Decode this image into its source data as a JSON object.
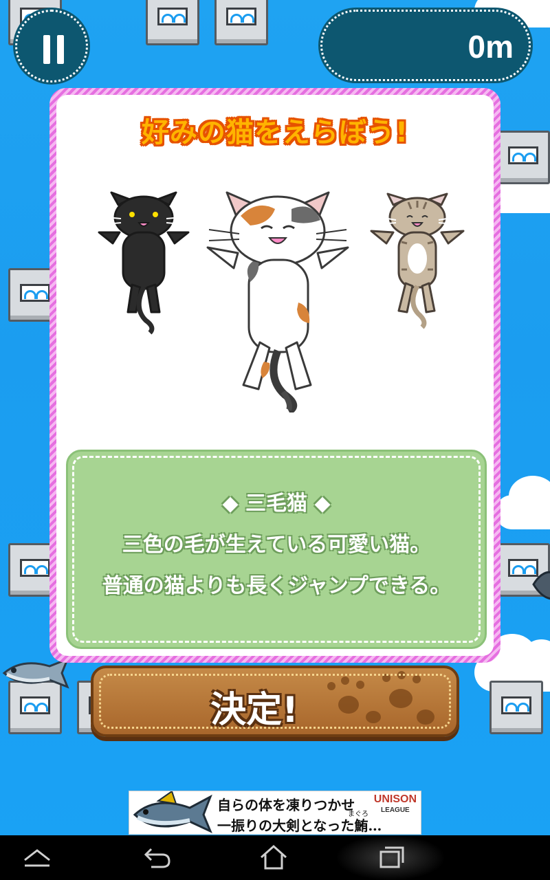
{
  "hud": {
    "distance": "0m"
  },
  "panel": {
    "title": "好みの猫をえらぼう!",
    "description_lines": [
      "◆ 三毛猫 ◆",
      "三色の毛が生えている可愛い猫。",
      "普通の猫よりも長くジャンプできる。"
    ]
  },
  "decide_button": {
    "label": "決定!"
  },
  "ad": {
    "line1": "自らの体を凍りつかせ",
    "line2": "一振りの大剣となった鮪…",
    "ruby": "まぐろ",
    "brand": "UNISON",
    "brand_sub": "LEAGUE"
  },
  "colors": {
    "sky": "#1b9df0",
    "hud_bg": "#0d5770",
    "panel_border": "#e56fe0",
    "desc_bg": "#a7d492",
    "button_bg": "#b8793a",
    "title_fill": "#ffb400",
    "title_outline": "#e65200"
  },
  "icons": [
    "pause-icon",
    "back-icon",
    "home-icon",
    "recent-apps-icon",
    "hide-keyboard-icon"
  ]
}
